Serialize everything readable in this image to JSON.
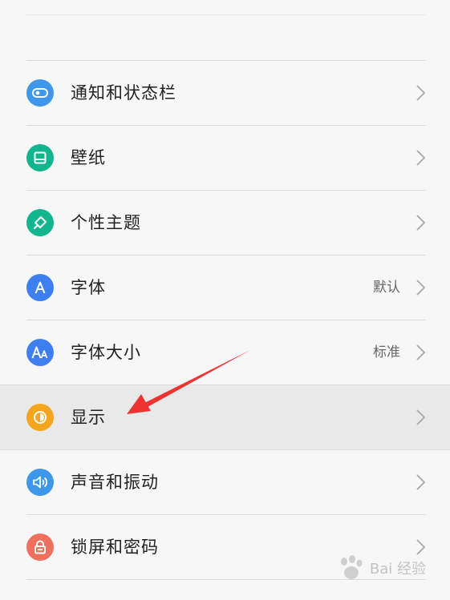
{
  "colors": {
    "notifications": "#3e97e8",
    "wallpaper": "#12b58d",
    "theme": "#12b58d",
    "font": "#3e7ff0",
    "font_size": "#3e7ff0",
    "display": "#f6a51e",
    "sound": "#3e97e8",
    "lockscreen": "#f0705f",
    "arrow": "#ee3333"
  },
  "settings": {
    "items": [
      {
        "label": "通知和状态栏",
        "value": "",
        "icon": "toggle-icon"
      },
      {
        "label": "壁纸",
        "value": "",
        "icon": "wallpaper-icon"
      },
      {
        "label": "个性主题",
        "value": "",
        "icon": "brush-icon"
      },
      {
        "label": "字体",
        "value": "默认",
        "icon": "letter-a-icon"
      },
      {
        "label": "字体大小",
        "value": "标准",
        "icon": "font-size-icon"
      },
      {
        "label": "显示",
        "value": "",
        "icon": "brightness-icon"
      },
      {
        "label": "声音和振动",
        "value": "",
        "icon": "speaker-icon"
      },
      {
        "label": "锁屏和密码",
        "value": "",
        "icon": "lock-icon"
      }
    ]
  },
  "watermark": {
    "text": "Bai 经验"
  }
}
